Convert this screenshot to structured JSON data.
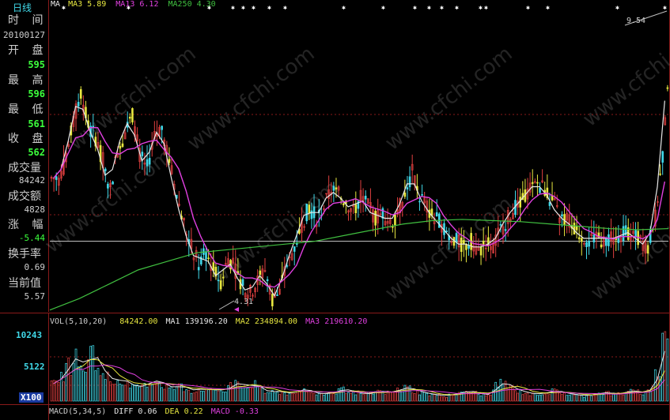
{
  "period_label": "日线",
  "info_panel": {
    "time_label": "时 间",
    "date": "20100127",
    "open_label": "开 盘",
    "open": "595",
    "high_label": "最 高",
    "high": "596",
    "low_label": "最 低",
    "low": "561",
    "close_label": "收 盘",
    "close": "562",
    "vol_label": "成交量",
    "vol": "84242",
    "amount_label": "成交额",
    "amount": "4828",
    "change_label": "涨 幅",
    "change": "-5.44",
    "turnover_label": "换手率",
    "turnover": "0.69",
    "current_label": "当前值",
    "current": "5.57"
  },
  "price_legend": {
    "ma": "MA",
    "ma3": "MA3 5.89",
    "ma13": "MA13 6.12",
    "ma250": "MA250 4.30"
  },
  "vol_legend": {
    "vol": "VOL(5,10,20)",
    "value": "84242.00",
    "ma1": "MA1 139196.20",
    "ma2": "MA2 234894.00",
    "ma3": "MA3 219610.20"
  },
  "macd_legend": {
    "macd": "MACD(5,34,5)",
    "diff": "DIFF 0.06",
    "dea": "DEA 0.22",
    "macdv": "MACD -0.33"
  },
  "vol_axis": {
    "top": "10243",
    "mid": "5122",
    "unit": "X100"
  },
  "watermark": "www.cfchi.com",
  "annotations": {
    "high": "9.54",
    "low": "4.31"
  },
  "colors": {
    "bg": "#000000",
    "border": "#8a1a1a",
    "ma3": "#e8e8e8",
    "ma13": "#e040e0",
    "ma250": "#40c040",
    "up": "#e04040",
    "down": "#40d8e8",
    "yellow": "#e8e840"
  },
  "chart_data": {
    "type": "candlestick",
    "price_range": [
      4.31,
      9.54
    ],
    "reference_price": 5.5,
    "price_high": 9.54,
    "price_low": 4.31,
    "price_series": [
      6.6,
      6.9,
      7.6,
      8.1,
      7.5,
      7.3,
      6.9,
      6.4,
      7.1,
      7.4,
      7.7,
      7.0,
      6.8,
      7.3,
      7.5,
      6.9,
      6.3,
      5.8,
      5.4,
      5.1,
      5.3,
      5.0,
      4.8,
      5.2,
      5.0,
      4.7,
      4.6,
      4.8,
      5.0,
      4.5,
      4.6,
      5.1,
      5.4,
      5.8,
      6.1,
      5.9,
      6.1,
      6.4,
      6.3,
      6.2,
      6.0,
      6.3,
      6.1,
      5.9,
      6.0,
      5.8,
      6.0,
      6.3,
      6.7,
      6.3,
      6.1,
      5.9,
      5.8,
      5.6,
      5.5,
      5.4,
      5.5,
      5.3,
      5.5,
      5.4,
      5.7,
      5.9,
      6.1,
      6.2,
      6.4,
      6.5,
      6.4,
      6.2,
      5.9,
      5.9,
      5.7,
      5.6,
      5.5,
      5.6,
      5.5,
      5.6,
      5.5,
      5.7,
      5.6,
      5.5,
      5.4,
      5.9,
      7.0,
      8.9
    ],
    "ma250_series": [
      4.3,
      4.5,
      4.75,
      5.0,
      5.15,
      5.3,
      5.35,
      5.4,
      5.45,
      5.5,
      5.6,
      5.7,
      5.8,
      5.86,
      5.88,
      5.86,
      5.84,
      5.8,
      5.76,
      5.72,
      5.7,
      5.72
    ],
    "volume_axis": [
      0,
      10243
    ],
    "volume_series": [
      20,
      30,
      42,
      55,
      35,
      60,
      40,
      30,
      22,
      26,
      20,
      16,
      18,
      22,
      24,
      18,
      15,
      18,
      14,
      12,
      15,
      12,
      14,
      12,
      18,
      22,
      16,
      20,
      14,
      10,
      12,
      10,
      9,
      12,
      14,
      10,
      8,
      9,
      10,
      14,
      12,
      10,
      8,
      9,
      12,
      10,
      11,
      14,
      16,
      12,
      10,
      8,
      7,
      6,
      8,
      9,
      12,
      10,
      8,
      7,
      18,
      22,
      16,
      12,
      10,
      8,
      9,
      10,
      12,
      10,
      8,
      7,
      6,
      8,
      9,
      10,
      8,
      9,
      12,
      11,
      10,
      15,
      35,
      80
    ]
  }
}
